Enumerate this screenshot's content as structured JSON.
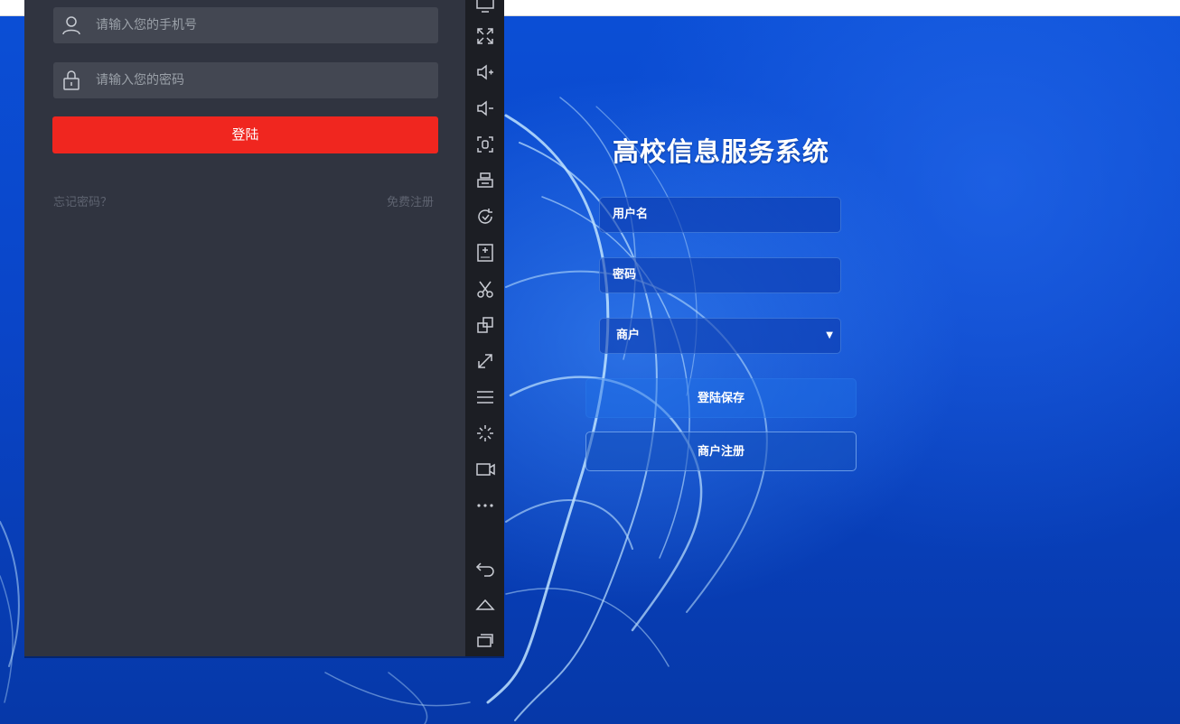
{
  "webpage": {
    "title": "高校信息服务系统",
    "username_placeholder": "用户名",
    "password_placeholder": "密码",
    "role_select_value": "商户",
    "save_login_button": "登陆保存",
    "merchant_register_button": "商户注册"
  },
  "emulator": {
    "phone_placeholder": "请输入您的手机号",
    "password_placeholder": "请输入您的密码",
    "login_button": "登陆",
    "forgot_password": "忘记密码？",
    "free_register": "免费注册",
    "toolbar_icons": [
      "monitor-icon",
      "fullscreen-icon",
      "volume-up-icon",
      "volume-down-icon",
      "screenshot-icon",
      "printer-icon",
      "rotate-icon",
      "install-apk-icon",
      "scissors-icon",
      "multi-window-icon",
      "resize-icon",
      "menu-icon",
      "loading-icon",
      "video-record-icon",
      "more-icon",
      "back-icon",
      "home-icon",
      "recent-apps-icon"
    ]
  },
  "colors": {
    "accent_red": "#f0261f",
    "emulator_bg": "#303440",
    "web_blue": "#0a45c8"
  }
}
